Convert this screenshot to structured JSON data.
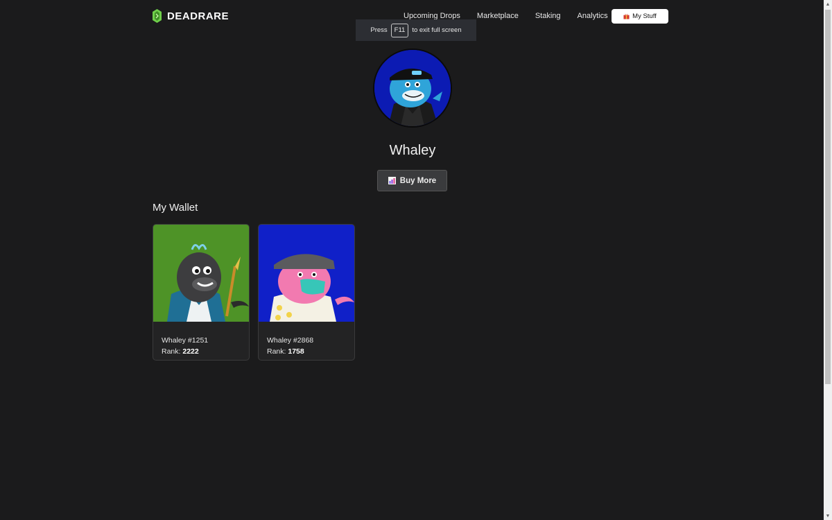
{
  "brand": {
    "name": "DEADRARE",
    "accent": "#6fcf4a"
  },
  "nav": {
    "items": [
      "Upcoming Drops",
      "Marketplace",
      "Staking",
      "Analytics"
    ],
    "my_stuff_label": "My Stuff"
  },
  "fullscreen_toast": {
    "before": "Press",
    "key": "F11",
    "after": "to exit full screen"
  },
  "profile": {
    "name": "Whaley",
    "buy_more_label": "Buy More"
  },
  "wallet": {
    "title": "My Wallet",
    "items": [
      {
        "name": "Whaley #1251",
        "rank_label": "Rank:",
        "rank": "2222",
        "bg": "#4e9327"
      },
      {
        "name": "Whaley #2868",
        "rank_label": "Rank:",
        "rank": "1758",
        "bg": "#1020c8"
      }
    ]
  },
  "colors": {
    "background": "#1b1b1c",
    "card": "#232324",
    "button": "#3a3b3d"
  }
}
